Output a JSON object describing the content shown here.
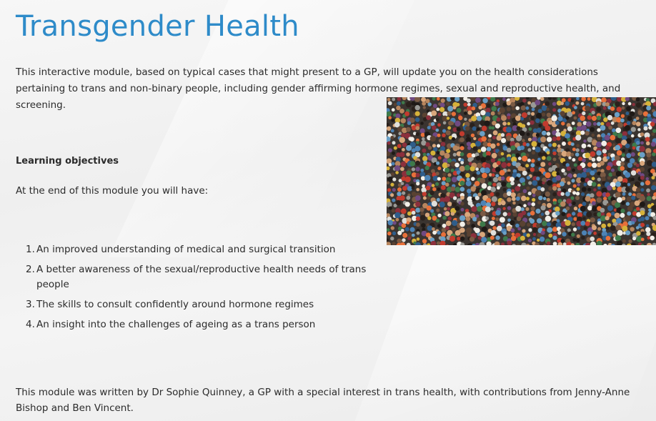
{
  "page": {
    "title": "Transgender Health",
    "intro": "This interactive module, based on typical cases that might present to a GP, will update you on the health considerations pertaining to trans and non-binary people, including gender affirming hormone regimes, sexual and reproductive health, and screening."
  },
  "learning_objectives": {
    "heading": "Learning objectives",
    "intro": "At the end of this module you will have:",
    "items": [
      {
        "number": "1.",
        "text": "An improved understanding of medical and surgical transition"
      },
      {
        "number": "2.",
        "text": "A better awareness of the sexual/reproductive health needs of trans people"
      },
      {
        "number": "3.",
        "text": "The skills to consult confidently around hormone regimes"
      },
      {
        "number": "4.",
        "text": "An insight into the challenges of ageing as a trans person"
      }
    ]
  },
  "author_note": "This module was written by Dr Sophie Quinney, a GP with a special interest in trans health, with contributions from Jenny-Anne Bishop and Ben Vincent.",
  "colors": {
    "title": "#2e8bc9",
    "body_text": "#2b2b2b",
    "background": "#f2f2f2"
  }
}
